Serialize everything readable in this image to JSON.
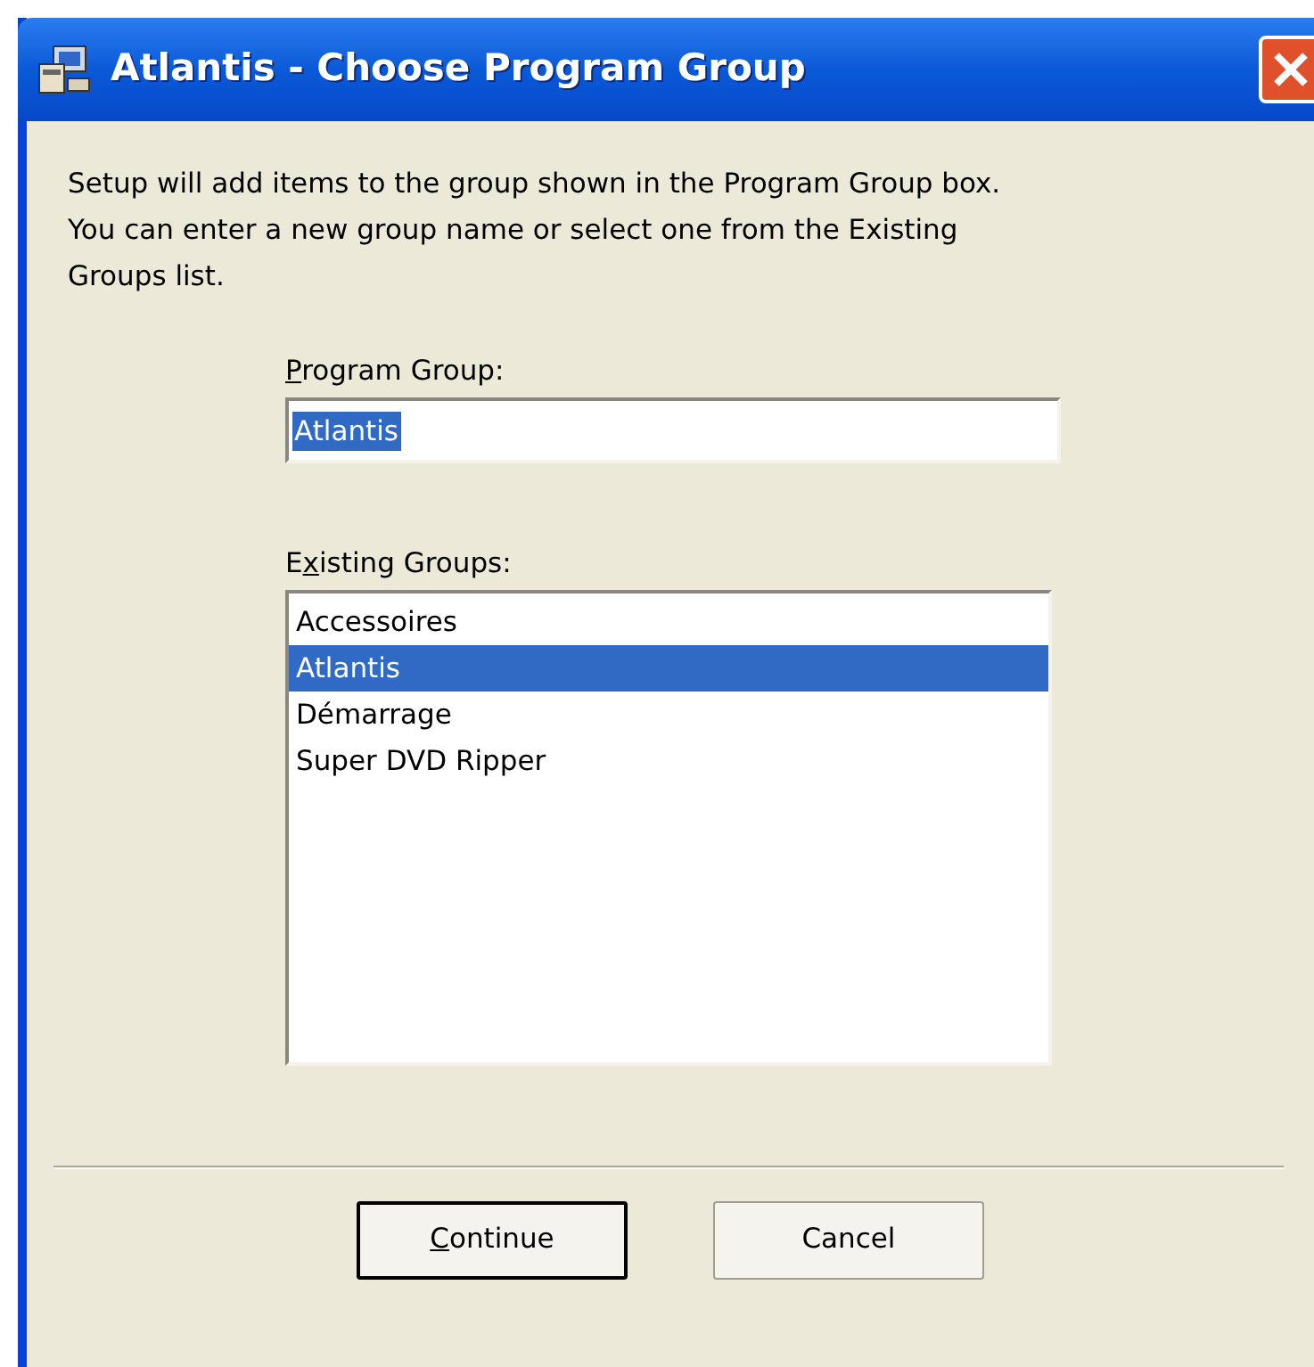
{
  "window": {
    "title": "Atlantis - Choose Program Group"
  },
  "description": "Setup will add items to the group shown in the Program Group box. You can enter a new group name or select one from the Existing Groups list.",
  "program_group": {
    "label": {
      "key": "P",
      "after": "rogram Group:"
    },
    "value": "Atlantis",
    "text_selected": true
  },
  "existing_groups": {
    "label": {
      "before": "E",
      "key": "x",
      "after": "isting Groups:"
    },
    "items": [
      {
        "label": "Accessoires",
        "selected": false
      },
      {
        "label": "Atlantis",
        "selected": true
      },
      {
        "label": "Démarrage",
        "selected": false
      },
      {
        "label": "Super DVD Ripper",
        "selected": false
      }
    ]
  },
  "buttons": [
    {
      "key": "C",
      "after": "ontinue",
      "default": true
    },
    {
      "before": "Cancel",
      "default": false
    }
  ]
}
